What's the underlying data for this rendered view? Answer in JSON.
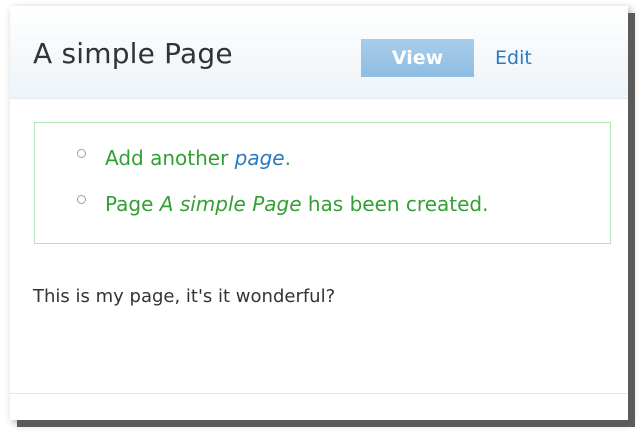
{
  "page": {
    "title": "A simple Page"
  },
  "tabs": [
    {
      "label": "View",
      "active": true
    },
    {
      "label": "Edit",
      "active": false
    }
  ],
  "messages": {
    "items": [
      {
        "prefix": "Add another ",
        "link": "page",
        "suffix": "."
      },
      {
        "prefix": "Page ",
        "emphasis": "A simple Page",
        "suffix": " has been created."
      }
    ]
  },
  "content": {
    "body": "This is my page, it's it wonderful?"
  },
  "colors": {
    "status_text": "#33a033",
    "status_border": "#b6e6b6",
    "link": "#2a7ac0",
    "active_tab": "#8dbde2"
  }
}
